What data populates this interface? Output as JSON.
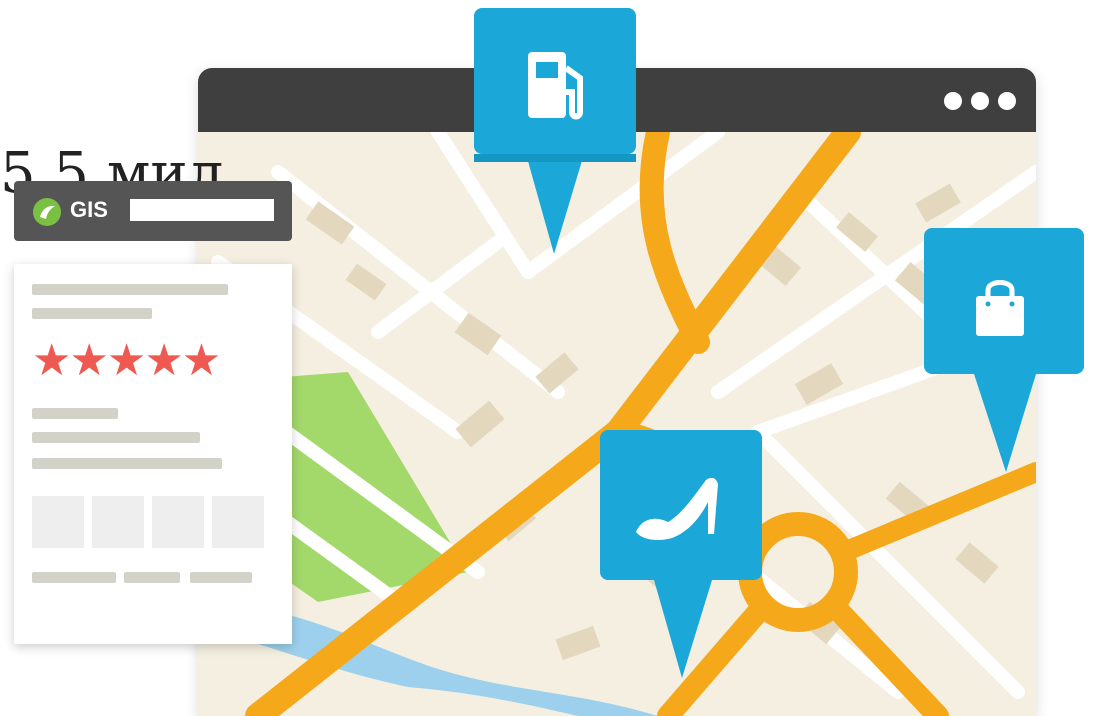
{
  "overlay_text": "5,5 мил",
  "gis_widget": {
    "brand_label": "GIS",
    "rating_stars": "★★★★★"
  },
  "pins": [
    {
      "name": "fuel-pin",
      "icon": "fuel-pump-icon"
    },
    {
      "name": "shopping-pin",
      "icon": "shopping-bag-icon"
    },
    {
      "name": "shoes-pin",
      "icon": "high-heel-shoe-icon"
    }
  ],
  "colors": {
    "pin_blue": "#1ba8d8",
    "road_orange": "#f5a91a",
    "titlebar": "#3f3f3f",
    "park_green": "#a3d96b",
    "water_blue": "#9cd0ec",
    "star_red": "#ee5a52"
  }
}
